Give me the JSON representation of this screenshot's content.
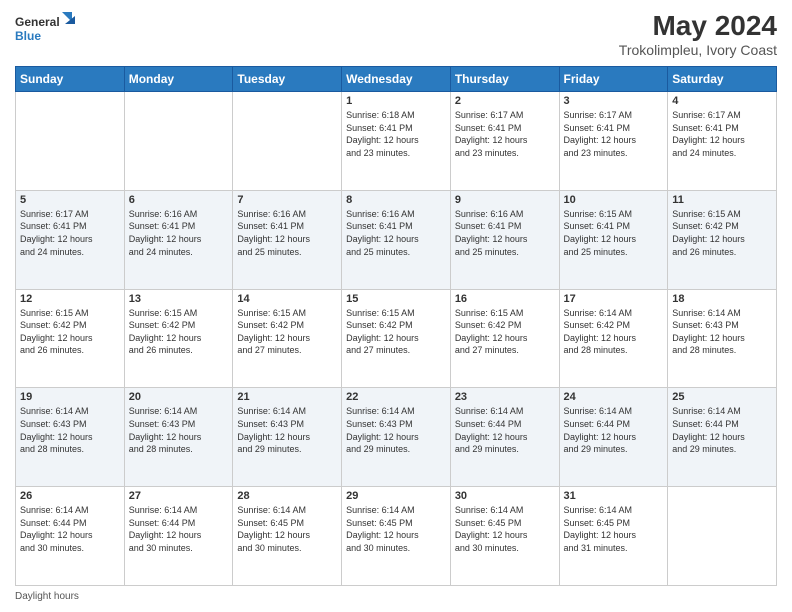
{
  "header": {
    "logo_line1": "General",
    "logo_line2": "Blue",
    "main_title": "May 2024",
    "subtitle": "Trokolimpleu, Ivory Coast"
  },
  "calendar": {
    "days_of_week": [
      "Sunday",
      "Monday",
      "Tuesday",
      "Wednesday",
      "Thursday",
      "Friday",
      "Saturday"
    ],
    "weeks": [
      [
        {
          "day": "",
          "info": ""
        },
        {
          "day": "",
          "info": ""
        },
        {
          "day": "",
          "info": ""
        },
        {
          "day": "1",
          "info": "Sunrise: 6:18 AM\nSunset: 6:41 PM\nDaylight: 12 hours\nand 23 minutes."
        },
        {
          "day": "2",
          "info": "Sunrise: 6:17 AM\nSunset: 6:41 PM\nDaylight: 12 hours\nand 23 minutes."
        },
        {
          "day": "3",
          "info": "Sunrise: 6:17 AM\nSunset: 6:41 PM\nDaylight: 12 hours\nand 23 minutes."
        },
        {
          "day": "4",
          "info": "Sunrise: 6:17 AM\nSunset: 6:41 PM\nDaylight: 12 hours\nand 24 minutes."
        }
      ],
      [
        {
          "day": "5",
          "info": "Sunrise: 6:17 AM\nSunset: 6:41 PM\nDaylight: 12 hours\nand 24 minutes."
        },
        {
          "day": "6",
          "info": "Sunrise: 6:16 AM\nSunset: 6:41 PM\nDaylight: 12 hours\nand 24 minutes."
        },
        {
          "day": "7",
          "info": "Sunrise: 6:16 AM\nSunset: 6:41 PM\nDaylight: 12 hours\nand 25 minutes."
        },
        {
          "day": "8",
          "info": "Sunrise: 6:16 AM\nSunset: 6:41 PM\nDaylight: 12 hours\nand 25 minutes."
        },
        {
          "day": "9",
          "info": "Sunrise: 6:16 AM\nSunset: 6:41 PM\nDaylight: 12 hours\nand 25 minutes."
        },
        {
          "day": "10",
          "info": "Sunrise: 6:15 AM\nSunset: 6:41 PM\nDaylight: 12 hours\nand 25 minutes."
        },
        {
          "day": "11",
          "info": "Sunrise: 6:15 AM\nSunset: 6:42 PM\nDaylight: 12 hours\nand 26 minutes."
        }
      ],
      [
        {
          "day": "12",
          "info": "Sunrise: 6:15 AM\nSunset: 6:42 PM\nDaylight: 12 hours\nand 26 minutes."
        },
        {
          "day": "13",
          "info": "Sunrise: 6:15 AM\nSunset: 6:42 PM\nDaylight: 12 hours\nand 26 minutes."
        },
        {
          "day": "14",
          "info": "Sunrise: 6:15 AM\nSunset: 6:42 PM\nDaylight: 12 hours\nand 27 minutes."
        },
        {
          "day": "15",
          "info": "Sunrise: 6:15 AM\nSunset: 6:42 PM\nDaylight: 12 hours\nand 27 minutes."
        },
        {
          "day": "16",
          "info": "Sunrise: 6:15 AM\nSunset: 6:42 PM\nDaylight: 12 hours\nand 27 minutes."
        },
        {
          "day": "17",
          "info": "Sunrise: 6:14 AM\nSunset: 6:42 PM\nDaylight: 12 hours\nand 28 minutes."
        },
        {
          "day": "18",
          "info": "Sunrise: 6:14 AM\nSunset: 6:43 PM\nDaylight: 12 hours\nand 28 minutes."
        }
      ],
      [
        {
          "day": "19",
          "info": "Sunrise: 6:14 AM\nSunset: 6:43 PM\nDaylight: 12 hours\nand 28 minutes."
        },
        {
          "day": "20",
          "info": "Sunrise: 6:14 AM\nSunset: 6:43 PM\nDaylight: 12 hours\nand 28 minutes."
        },
        {
          "day": "21",
          "info": "Sunrise: 6:14 AM\nSunset: 6:43 PM\nDaylight: 12 hours\nand 29 minutes."
        },
        {
          "day": "22",
          "info": "Sunrise: 6:14 AM\nSunset: 6:43 PM\nDaylight: 12 hours\nand 29 minutes."
        },
        {
          "day": "23",
          "info": "Sunrise: 6:14 AM\nSunset: 6:44 PM\nDaylight: 12 hours\nand 29 minutes."
        },
        {
          "day": "24",
          "info": "Sunrise: 6:14 AM\nSunset: 6:44 PM\nDaylight: 12 hours\nand 29 minutes."
        },
        {
          "day": "25",
          "info": "Sunrise: 6:14 AM\nSunset: 6:44 PM\nDaylight: 12 hours\nand 29 minutes."
        }
      ],
      [
        {
          "day": "26",
          "info": "Sunrise: 6:14 AM\nSunset: 6:44 PM\nDaylight: 12 hours\nand 30 minutes."
        },
        {
          "day": "27",
          "info": "Sunrise: 6:14 AM\nSunset: 6:44 PM\nDaylight: 12 hours\nand 30 minutes."
        },
        {
          "day": "28",
          "info": "Sunrise: 6:14 AM\nSunset: 6:45 PM\nDaylight: 12 hours\nand 30 minutes."
        },
        {
          "day": "29",
          "info": "Sunrise: 6:14 AM\nSunset: 6:45 PM\nDaylight: 12 hours\nand 30 minutes."
        },
        {
          "day": "30",
          "info": "Sunrise: 6:14 AM\nSunset: 6:45 PM\nDaylight: 12 hours\nand 30 minutes."
        },
        {
          "day": "31",
          "info": "Sunrise: 6:14 AM\nSunset: 6:45 PM\nDaylight: 12 hours\nand 31 minutes."
        },
        {
          "day": "",
          "info": ""
        }
      ]
    ]
  },
  "footer": {
    "daylight_label": "Daylight hours"
  }
}
